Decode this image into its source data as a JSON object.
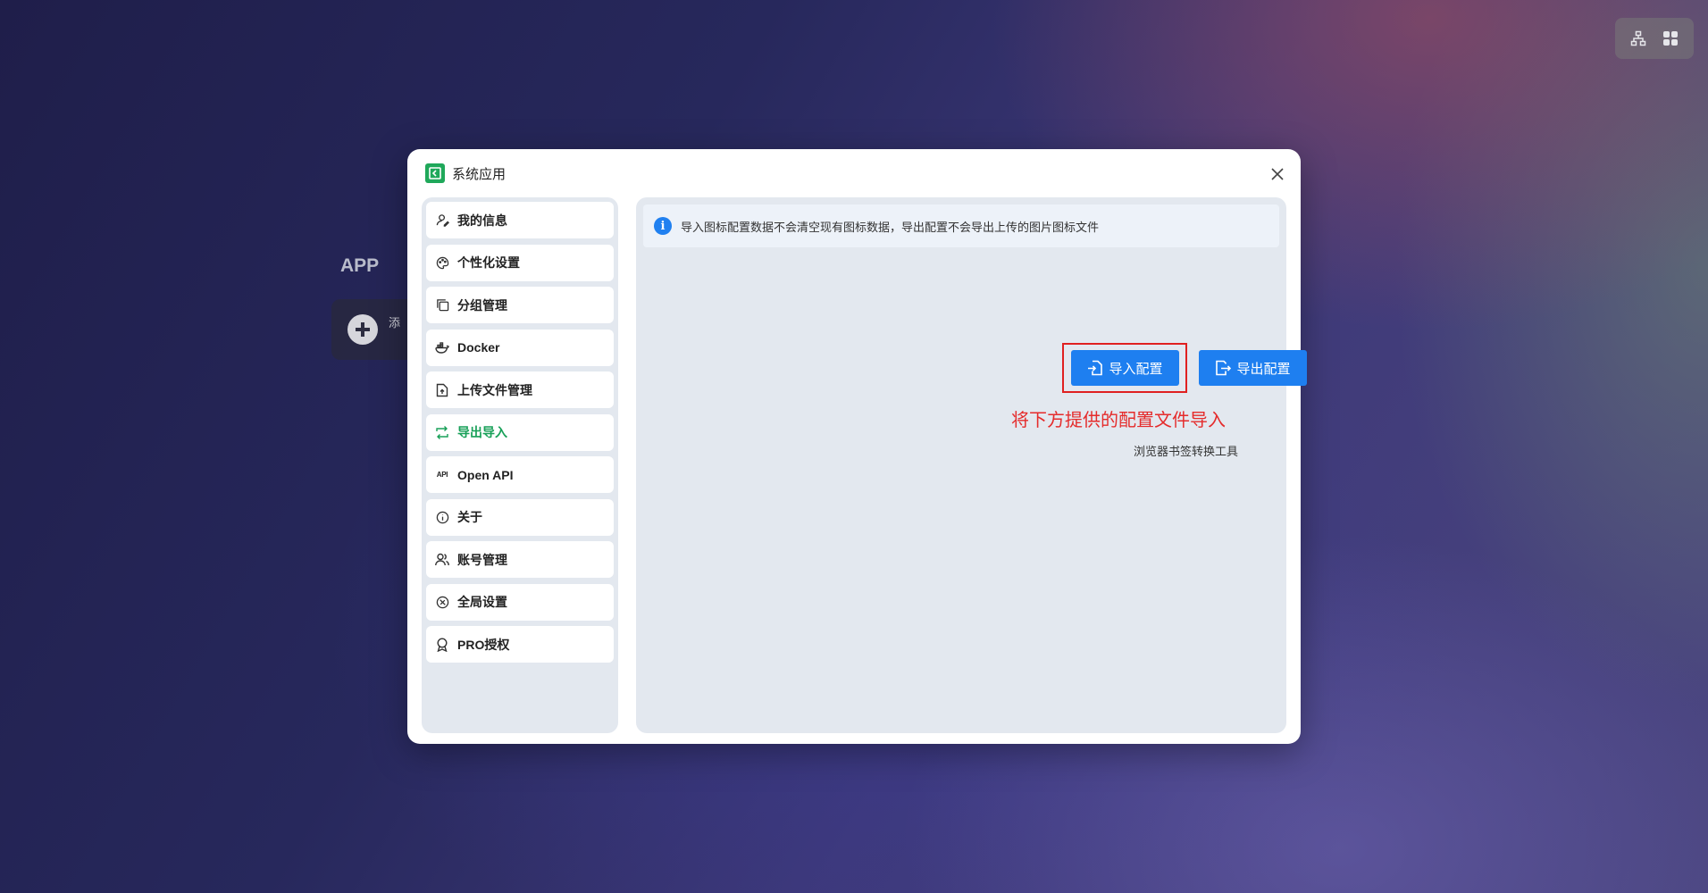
{
  "corner_tools": {
    "icons": [
      "sitemap-icon",
      "grid-icon"
    ]
  },
  "background": {
    "app_label": "APP",
    "add_card_text": "添"
  },
  "modal": {
    "title": "系统应用",
    "sidebar": {
      "items": [
        {
          "label": "我的信息",
          "icon": "user-edit-icon"
        },
        {
          "label": "个性化设置",
          "icon": "palette-icon"
        },
        {
          "label": "分组管理",
          "icon": "copy-icon"
        },
        {
          "label": "Docker",
          "icon": "docker-icon"
        },
        {
          "label": "上传文件管理",
          "icon": "file-upload-icon"
        },
        {
          "label": "导出导入",
          "icon": "transfer-icon",
          "active": true
        },
        {
          "label": "Open API",
          "icon": "api-icon",
          "icon_text": "API"
        },
        {
          "label": "关于",
          "icon": "info-icon"
        },
        {
          "label": "账号管理",
          "icon": "users-icon"
        },
        {
          "label": "全局设置",
          "icon": "settings-icon"
        },
        {
          "label": "PRO授权",
          "icon": "award-icon"
        }
      ]
    },
    "content": {
      "notice": "导入图标配置数据不会清空现有图标数据，导出配置不会导出上传的图片图标文件",
      "import_button": "导入配置",
      "export_button": "导出配置",
      "annotation": "将下方提供的配置文件导入",
      "tool_link": "浏览器书签转换工具"
    }
  },
  "colors": {
    "accent_green": "#18a058",
    "primary_blue": "#1e7ff0",
    "annotation_red": "#e52b2b"
  }
}
